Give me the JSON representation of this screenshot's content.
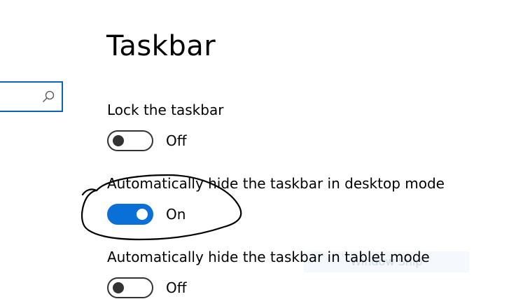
{
  "search": {
    "value": "",
    "placeholder": "",
    "icon": "search-icon"
  },
  "page": {
    "title": "Taskbar"
  },
  "settings": [
    {
      "label": "Lock the taskbar",
      "state_label": "Off",
      "on": false
    },
    {
      "label": "Automatically hide the taskbar in desktop mode",
      "state_label": "On",
      "on": true
    },
    {
      "label": "Automatically hide the taskbar in tablet mode",
      "state_label": "Off",
      "on": false
    }
  ],
  "overlay": {
    "text": "Window Snip"
  },
  "colors": {
    "accent": "#0a6fd7",
    "search_border": "#0a64b9",
    "toggle_off": "#333333",
    "annotation": "#000000"
  }
}
